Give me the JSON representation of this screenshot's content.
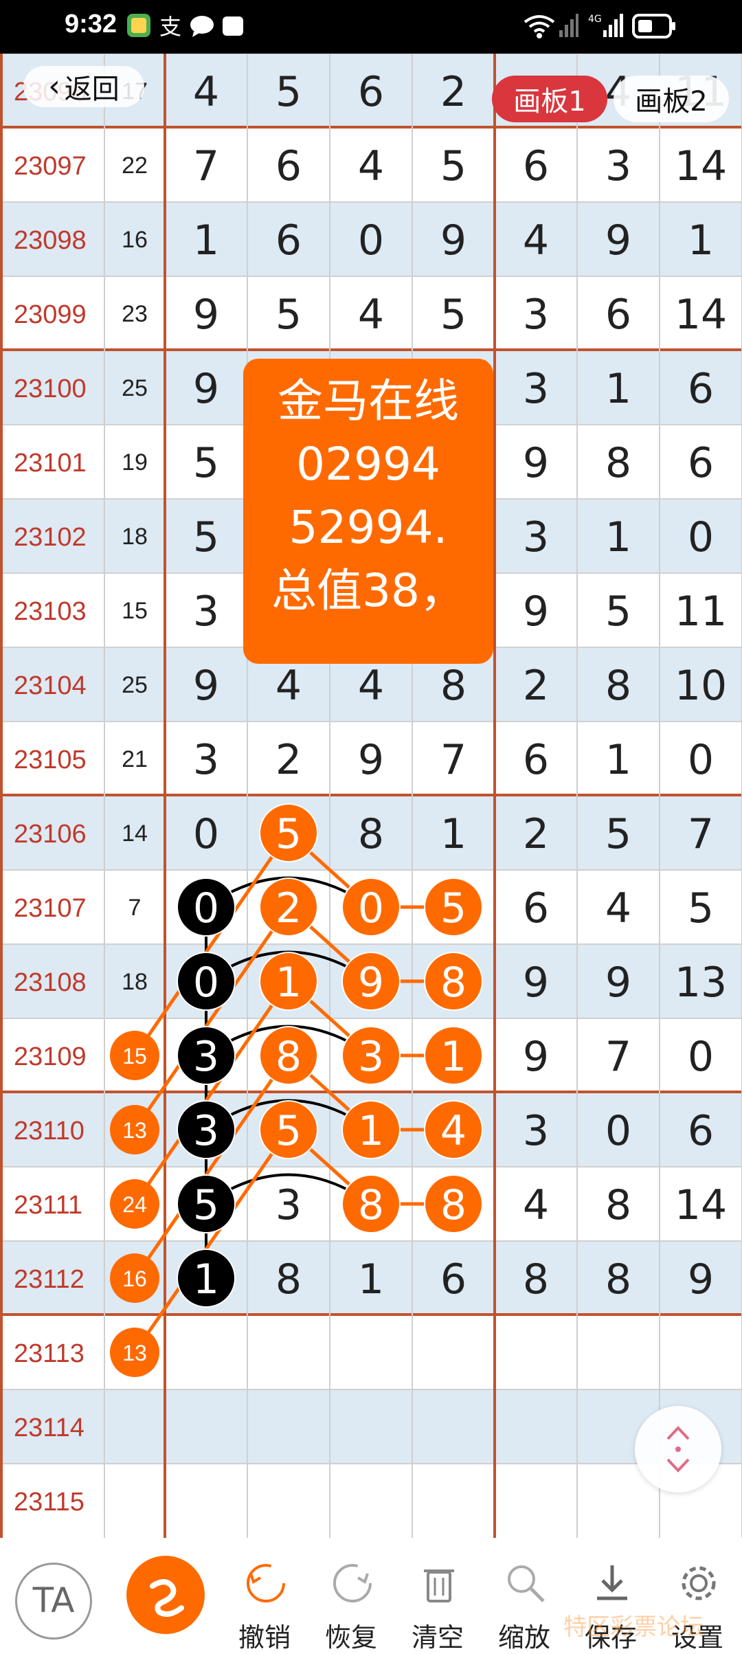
{
  "status_bar": {
    "time": "9:32",
    "network": "4G"
  },
  "nav": {
    "back_label": "返回",
    "tab1_label": "画板1",
    "tab2_label": "画板2"
  },
  "note": {
    "lines": [
      "金马在线",
      "02994",
      "52994.",
      "总值38，"
    ]
  },
  "colors": {
    "accent": "#ff6a00",
    "tab_active": "#d9363e",
    "row_tint": "#dde9f3",
    "grid_line": "#c0532e",
    "issue_text": "#c0392b"
  },
  "table": {
    "rows": [
      {
        "issue": "23096",
        "total": "17",
        "d": [
          "4",
          "5",
          "6",
          "2",
          "",
          "4",
          "11"
        ]
      },
      {
        "issue": "23097",
        "total": "22",
        "d": [
          "7",
          "6",
          "4",
          "5",
          "6",
          "3",
          "14"
        ]
      },
      {
        "issue": "23098",
        "total": "16",
        "d": [
          "1",
          "6",
          "0",
          "9",
          "4",
          "9",
          "1"
        ]
      },
      {
        "issue": "23099",
        "total": "23",
        "d": [
          "9",
          "5",
          "4",
          "5",
          "3",
          "6",
          "14"
        ]
      },
      {
        "issue": "23100",
        "total": "25",
        "d": [
          "9",
          "",
          "",
          "",
          "3",
          "1",
          "6"
        ]
      },
      {
        "issue": "23101",
        "total": "19",
        "d": [
          "5",
          "",
          "",
          "",
          "9",
          "8",
          "6"
        ]
      },
      {
        "issue": "23102",
        "total": "18",
        "d": [
          "5",
          "",
          "",
          "",
          "3",
          "1",
          "0"
        ]
      },
      {
        "issue": "23103",
        "total": "15",
        "d": [
          "3",
          "",
          "",
          "",
          "9",
          "5",
          "11"
        ]
      },
      {
        "issue": "23104",
        "total": "25",
        "d": [
          "9",
          "4",
          "4",
          "8",
          "2",
          "8",
          "10"
        ]
      },
      {
        "issue": "23105",
        "total": "21",
        "d": [
          "3",
          "2",
          "9",
          "7",
          "6",
          "1",
          "0"
        ]
      },
      {
        "issue": "23106",
        "total": "14",
        "d": [
          "0",
          "5",
          "8",
          "1",
          "2",
          "5",
          "7"
        ]
      },
      {
        "issue": "23107",
        "total": "7",
        "d": [
          "0",
          "2",
          "0",
          "5",
          "6",
          "4",
          "5"
        ]
      },
      {
        "issue": "23108",
        "total": "18",
        "d": [
          "0",
          "1",
          "9",
          "8",
          "9",
          "9",
          "13"
        ]
      },
      {
        "issue": "23109",
        "total": "",
        "d": [
          "3",
          "8",
          "3",
          "1",
          "9",
          "7",
          "0"
        ]
      },
      {
        "issue": "23110",
        "total": "",
        "d": [
          "3",
          "5",
          "1",
          "4",
          "3",
          "0",
          "6"
        ]
      },
      {
        "issue": "23111",
        "total": "",
        "d": [
          "5",
          "3",
          "8",
          "8",
          "4",
          "8",
          "14"
        ]
      },
      {
        "issue": "23112",
        "total": "",
        "d": [
          "1",
          "8",
          "1",
          "6",
          "8",
          "8",
          "9"
        ]
      },
      {
        "issue": "23113",
        "total": "",
        "d": [
          "",
          "",
          "",
          "",
          "",
          "",
          ""
        ]
      },
      {
        "issue": "23114",
        "total": "",
        "d": [
          "",
          "",
          "",
          "",
          "",
          "",
          ""
        ]
      },
      {
        "issue": "23115",
        "total": "",
        "d": [
          "",
          "",
          "",
          "",
          "",
          "",
          ""
        ]
      }
    ]
  },
  "annotations": {
    "circles": [
      {
        "row": 10,
        "col": 1,
        "text": "5",
        "kind": "orange"
      },
      {
        "row": 11,
        "col": 0,
        "text": "0",
        "kind": "black"
      },
      {
        "row": 11,
        "col": 1,
        "text": "2",
        "kind": "orange"
      },
      {
        "row": 11,
        "col": 2,
        "text": "0",
        "kind": "orange"
      },
      {
        "row": 11,
        "col": 3,
        "text": "5",
        "kind": "orange"
      },
      {
        "row": 12,
        "col": 0,
        "text": "0",
        "kind": "black"
      },
      {
        "row": 12,
        "col": 1,
        "text": "1",
        "kind": "orange"
      },
      {
        "row": 12,
        "col": 2,
        "text": "9",
        "kind": "orange"
      },
      {
        "row": 12,
        "col": 3,
        "text": "8",
        "kind": "orange"
      },
      {
        "row": 13,
        "col": 0,
        "text": "3",
        "kind": "black"
      },
      {
        "row": 13,
        "col": 1,
        "text": "8",
        "kind": "orange"
      },
      {
        "row": 13,
        "col": 2,
        "text": "3",
        "kind": "orange"
      },
      {
        "row": 13,
        "col": 3,
        "text": "1",
        "kind": "orange"
      },
      {
        "row": 14,
        "col": 0,
        "text": "3",
        "kind": "black"
      },
      {
        "row": 14,
        "col": 1,
        "text": "5",
        "kind": "orange"
      },
      {
        "row": 14,
        "col": 2,
        "text": "1",
        "kind": "orange"
      },
      {
        "row": 14,
        "col": 3,
        "text": "4",
        "kind": "orange"
      },
      {
        "row": 15,
        "col": 0,
        "text": "5",
        "kind": "black"
      },
      {
        "row": 15,
        "col": 2,
        "text": "8",
        "kind": "orange"
      },
      {
        "row": 15,
        "col": 3,
        "text": "8",
        "kind": "orange"
      },
      {
        "row": 16,
        "col": 0,
        "text": "1",
        "kind": "black"
      }
    ],
    "total_bubbles": [
      {
        "row": 13,
        "text": "15"
      },
      {
        "row": 14,
        "text": "13"
      },
      {
        "row": 15,
        "text": "24"
      },
      {
        "row": 16,
        "text": "16"
      },
      {
        "row": 17,
        "text": "13"
      }
    ]
  },
  "toolbar": {
    "items": [
      {
        "label": "撤销",
        "icon": "undo-icon"
      },
      {
        "label": "恢复",
        "icon": "redo-icon"
      },
      {
        "label": "清空",
        "icon": "trash-icon"
      },
      {
        "label": "缩放",
        "icon": "zoom-icon"
      },
      {
        "label": "保存",
        "icon": "download-icon"
      },
      {
        "label": "设置",
        "icon": "gear-icon"
      }
    ],
    "font_button": "TA"
  },
  "watermark": "特区彩票论坛"
}
